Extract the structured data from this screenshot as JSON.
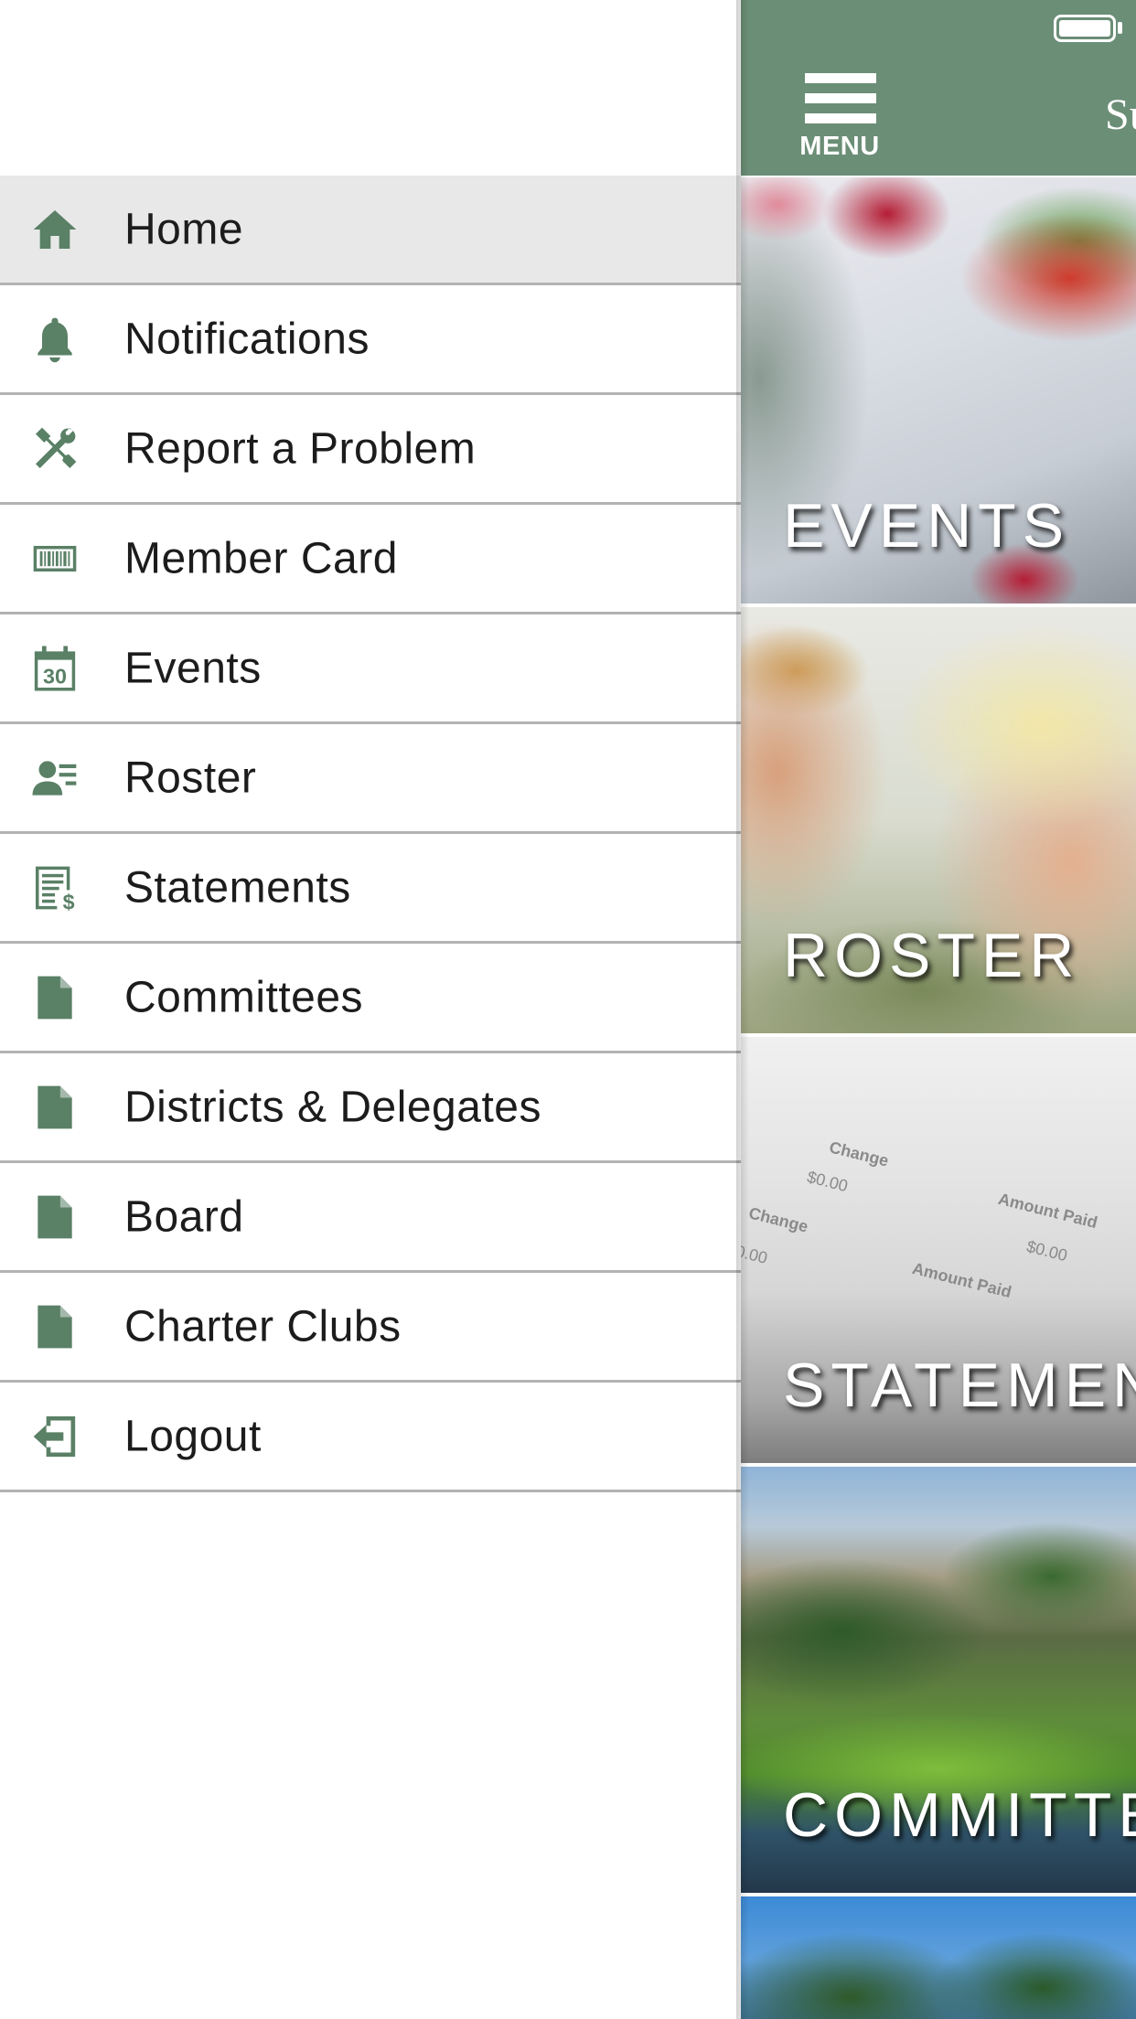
{
  "drawer": {
    "items": [
      {
        "label": "Home",
        "icon": "home-icon",
        "active": true
      },
      {
        "label": "Notifications",
        "icon": "bell-icon",
        "active": false
      },
      {
        "label": "Report a Problem",
        "icon": "tools-icon",
        "active": false
      },
      {
        "label": "Member Card",
        "icon": "barcode-icon",
        "active": false
      },
      {
        "label": "Events",
        "icon": "calendar-icon",
        "active": false
      },
      {
        "label": "Roster",
        "icon": "person-list-icon",
        "active": false
      },
      {
        "label": "Statements",
        "icon": "statement-icon",
        "active": false
      },
      {
        "label": "Committees",
        "icon": "document-icon",
        "active": false
      },
      {
        "label": "Districts & Delegates",
        "icon": "document-icon",
        "active": false
      },
      {
        "label": "Board",
        "icon": "document-icon",
        "active": false
      },
      {
        "label": "Charter Clubs",
        "icon": "document-icon",
        "active": false
      },
      {
        "label": "Logout",
        "icon": "logout-icon",
        "active": false
      }
    ],
    "calendar_day": "30"
  },
  "header": {
    "menu_label": "MENU",
    "brand_partial": "Su",
    "color": "#6b8e76"
  },
  "tiles": [
    {
      "label": "EVENTS"
    },
    {
      "label": "ROSTER"
    },
    {
      "label": "STATEMEN"
    },
    {
      "label": "COMMITTE"
    },
    {
      "label": ""
    }
  ],
  "statement_paper": {
    "change1": "Change",
    "amount1": "$0.00",
    "change2": "Change",
    "amount_paid1": "Amount Paid",
    "amount2": "$0.00",
    "amount_paid2": "Amount Paid",
    "amount3": "0.00"
  },
  "colors": {
    "accent": "#5a8066",
    "active_row": "#e8e8e8",
    "divider": "#b3b3b3"
  }
}
